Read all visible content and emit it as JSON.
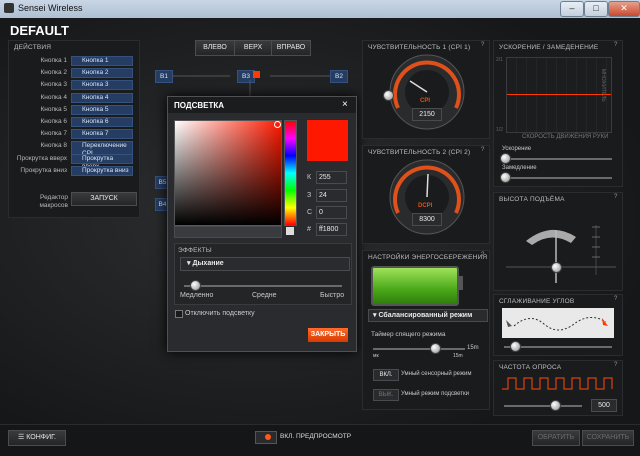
{
  "window": {
    "title": "Sensei Wireless",
    "min": "–",
    "max": "□",
    "close": "✕"
  },
  "profile": "DEFAULT",
  "actions": {
    "header": "ДЕЙСТВИЯ",
    "rows": [
      {
        "label": "Кнопка 1",
        "value": "Кнопка 1"
      },
      {
        "label": "Кнопка 2",
        "value": "Кнопка 2"
      },
      {
        "label": "Кнопка 3",
        "value": "Кнопка 3"
      },
      {
        "label": "Кнопка 4",
        "value": "Кнопка 4"
      },
      {
        "label": "Кнопка 5",
        "value": "Кнопка 5"
      },
      {
        "label": "Кнопка 6",
        "value": "Кнопка 6"
      },
      {
        "label": "Кнопка 7",
        "value": "Кнопка 7"
      },
      {
        "label": "Кнопка 8",
        "value": "Переключение CPI"
      },
      {
        "label": "Прокрутка вверх",
        "value": "Прокрутка вверх"
      },
      {
        "label": "Прокрутка вниз",
        "value": "Прокрутка вниз"
      }
    ],
    "macro_label": "Редактор макросов",
    "macro_button": "ЗАПУСК"
  },
  "orientation": {
    "left": "ВЛЕВО",
    "up": "ВЕРХ",
    "right": "ВПРАВО"
  },
  "mouse_buttons": {
    "b1": "B1",
    "b3": "B3",
    "b2": "B2",
    "b5": "B5",
    "b4": "B4"
  },
  "lighting": {
    "title": "ПОДСВЕТКА",
    "close": "×",
    "k_label": "К",
    "k": "255",
    "z_label": "З",
    "z": "24",
    "s_label": "С",
    "s": "0",
    "hex_label": "#",
    "hex": "ff1800",
    "effects_header": "ЭФФЕКТЫ",
    "effect": "Дыхание",
    "slow": "Медленно",
    "mid": "Средне",
    "fast": "Быстро",
    "speed": 0.05,
    "disable": "Отключить подсветку",
    "close_button": "ЗАКРЫТЬ",
    "color": "#ff1800"
  },
  "cpi1": {
    "header": "ЧУВСТВИТЕЛЬНОСТЬ 1 (CPI 1)",
    "label": "CPI",
    "value": "2150"
  },
  "cpi2": {
    "header": "ЧУВСТВИТЕЛЬНОСТЬ 2 (CPI 2)",
    "label": "DCPI",
    "value": "8300"
  },
  "accel": {
    "header": "УСКОРЕНИЕ / ЗАМЕДЕНЕНИЕ",
    "y_top": "2/1",
    "y_bottom": "1/2",
    "y_axis": "МНОЖИТЕЛЬ",
    "x_axis": "СКОРОСТЬ ДВИЖЕНИЯ РУКИ",
    "accel_label": "Ускорение",
    "decel_label": "Замедление"
  },
  "power": {
    "header": "НАСТРОЙКИ ЭНЕРГОСБЕРЕЖЕНИЯ",
    "mode": "Сбалансированный режим",
    "sleep_label": "Таймер спящего режима",
    "min": "мк",
    "max": "15m",
    "sleep_min": "15m",
    "smart_sensor": "Умный сенсорный режим",
    "smart_light": "Умный режим подсветки",
    "on": "ВКЛ.",
    "off": "ВЫК."
  },
  "lift": {
    "header": "ВЫСОТА ПОДЪЁМА"
  },
  "angle": {
    "header": "СГЛАЖИВАНИЕ УГЛОВ"
  },
  "polling": {
    "header": "ЧАСТОТА ОПРОСА",
    "value": "500"
  },
  "footer": {
    "config": "КОНФИГ.",
    "preview": "ВКЛ. ПРЕДПРОСМОТР",
    "reset": "ОБРАТИТЬ",
    "save": "СОХРАНИТЬ"
  },
  "colors": {
    "accent": "#ff3a00",
    "orange": "#e0501a",
    "blue": "#253d63"
  }
}
